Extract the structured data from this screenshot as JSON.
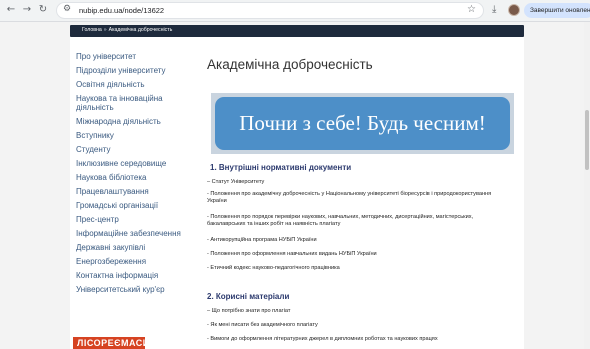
{
  "browser": {
    "url": "nubip.edu.ua/node/13622",
    "update_button": "Завершити оновлення",
    "icons": {
      "back": "arrow-left-icon",
      "forward": "arrow-right-icon",
      "reload": "reload-icon",
      "tune": "site-settings-icon",
      "star": "star-icon",
      "download": "download-icon"
    }
  },
  "breadcrumb": {
    "home": "Головна",
    "separator": "»",
    "current": "Академічна доброчесність"
  },
  "sidebar": {
    "items": [
      {
        "label": "Про університет"
      },
      {
        "label": "Підрозділи університету"
      },
      {
        "label": "Освітня діяльність"
      },
      {
        "label": "Наукова та інноваційна діяльність"
      },
      {
        "label": "Міжнародна діяльність"
      },
      {
        "label": "Вступнику"
      },
      {
        "label": "Студенту"
      },
      {
        "label": "Інклюзивне середовище"
      },
      {
        "label": "Наукова бібліотека"
      },
      {
        "label": "Працевлаштування"
      },
      {
        "label": "Громадські організації"
      },
      {
        "label": "Прес-центр"
      },
      {
        "label": "Інформаційне забезпечення"
      },
      {
        "label": "Державні закупівлі"
      },
      {
        "label": "Енергозбереження"
      },
      {
        "label": "Контактна інформація"
      },
      {
        "label": "Університетський кур'єр"
      }
    ]
  },
  "main": {
    "title": "Академічна доброчесність",
    "banner_text": "Почни з себе! Будь чесним!",
    "section1": {
      "heading": "1. Внутрішні нормативні документи",
      "items": [
        "– Статут Університету",
        "- Положення про академічну доброчесність у Національному університеті біоресурсів і природокористування України",
        "- Положення про порядок перевірки наукових, навчальних, методичних, дисертаційних, магістерських, бакалаврських та інших робіт на наявність плагіату",
        "- Антикорупційна програма НУБіП України",
        "- Положення про оформлення навчальних видань НУБіП України",
        "- Етичний кодекс науково-педагогічного працівника"
      ]
    },
    "section2": {
      "heading": "2. Корисні матеріали",
      "items": [
        "– Що потрібно знати про плагіат",
        "- Як мені писати без академічного плагіату",
        "- Вимоги до оформлення літературних джерел в дипломних роботах та наукових працях"
      ]
    }
  },
  "footer_logo": {
    "text": "ЛІСОРЕЄМАСИ"
  },
  "colors": {
    "breadcrumb_bg": "#1e2a3c",
    "sidebar_link": "#3a5a80",
    "heading": "#2c3a6e",
    "banner_fill": "#4d8fc8",
    "banner_frame": "#c9d4df",
    "logo_red": "#d64322"
  }
}
